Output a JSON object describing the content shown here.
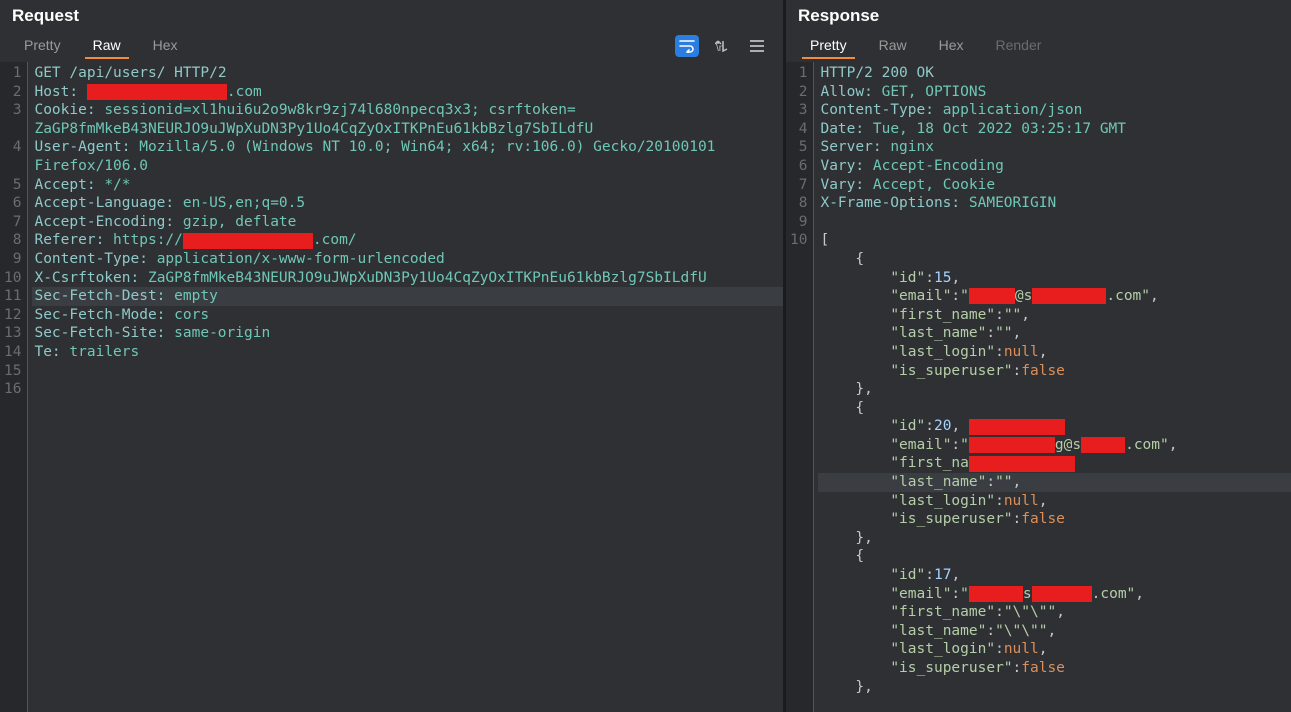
{
  "request": {
    "title": "Request",
    "tabs": {
      "pretty": "Pretty",
      "raw": "Raw",
      "hex": "Hex"
    },
    "active_tab": "raw",
    "lines": [
      {
        "n": 1,
        "parts": [
          {
            "cls": "tk-teal",
            "t": "GET"
          },
          {
            "cls": "tk-def",
            "t": " "
          },
          {
            "cls": "tk-teal",
            "t": "/api/users/"
          },
          {
            "cls": "tk-def",
            "t": " "
          },
          {
            "cls": "tk-teal",
            "t": "HTTP/2"
          }
        ]
      },
      {
        "n": 2,
        "parts": [
          {
            "cls": "tk-teal",
            "t": "Host:"
          },
          {
            "cls": "tk-def",
            "t": " "
          },
          {
            "redact": 140
          },
          {
            "cls": "tk-tealb",
            "t": ".com"
          }
        ]
      },
      {
        "n": 3,
        "wrap": true,
        "parts": [
          {
            "cls": "tk-teal",
            "t": "Cookie:"
          },
          {
            "cls": "tk-def",
            "t": " "
          },
          {
            "cls": "tk-tealb",
            "t": "sessionid=xl1hui6u2o9w8kr9zj74l680npecq3x3"
          },
          {
            "cls": "tk-tealb",
            "t": "; "
          },
          {
            "cls": "tk-tealb",
            "t": "csrftoken="
          }
        ]
      },
      {
        "n": null,
        "parts": [
          {
            "cls": "tk-tealb",
            "t": "ZaGP8fmMkeB43NEURJO9uJWpXuDN3Py1Uo4CqZyOxITKPnEu61kbBzlg7SbILdfU"
          }
        ]
      },
      {
        "n": 4,
        "wrap": true,
        "parts": [
          {
            "cls": "tk-teal",
            "t": "User-Agent:"
          },
          {
            "cls": "tk-def",
            "t": " "
          },
          {
            "cls": "tk-tealb",
            "t": "Mozilla/5.0 (Windows NT 10.0; Win64; x64; rv:106.0) Gecko/20100101 "
          }
        ]
      },
      {
        "n": null,
        "parts": [
          {
            "cls": "tk-tealb",
            "t": "Firefox/106.0"
          }
        ]
      },
      {
        "n": 5,
        "parts": [
          {
            "cls": "tk-teal",
            "t": "Accept:"
          },
          {
            "cls": "tk-def",
            "t": " "
          },
          {
            "cls": "tk-tealb",
            "t": "*/*"
          }
        ]
      },
      {
        "n": 6,
        "parts": [
          {
            "cls": "tk-teal",
            "t": "Accept-Language:"
          },
          {
            "cls": "tk-def",
            "t": " "
          },
          {
            "cls": "tk-tealb",
            "t": "en-US,en;q=0.5"
          }
        ]
      },
      {
        "n": 7,
        "parts": [
          {
            "cls": "tk-teal",
            "t": "Accept-Encoding:"
          },
          {
            "cls": "tk-def",
            "t": " "
          },
          {
            "cls": "tk-tealb",
            "t": "gzip, deflate"
          }
        ]
      },
      {
        "n": 8,
        "parts": [
          {
            "cls": "tk-teal",
            "t": "Referer:"
          },
          {
            "cls": "tk-def",
            "t": " "
          },
          {
            "cls": "tk-tealb",
            "t": "https://"
          },
          {
            "redact": 130
          },
          {
            "cls": "tk-tealb",
            "t": ".com/"
          }
        ]
      },
      {
        "n": 9,
        "parts": [
          {
            "cls": "tk-teal",
            "t": "Content-Type:"
          },
          {
            "cls": "tk-def",
            "t": " "
          },
          {
            "cls": "tk-tealb",
            "t": "application/x-www-form-urlencoded"
          }
        ]
      },
      {
        "n": 10,
        "parts": [
          {
            "cls": "tk-teal",
            "t": "X-Csrftoken:"
          },
          {
            "cls": "tk-def",
            "t": " "
          },
          {
            "cls": "tk-tealb",
            "t": "ZaGP8fmMkeB43NEURJO9uJWpXuDN3Py1Uo4CqZyOxITKPnEu61kbBzlg7SbILdfU"
          }
        ]
      },
      {
        "n": 11,
        "hl": true,
        "parts": [
          {
            "cls": "tk-teal",
            "t": "Sec-Fetch-Dest:"
          },
          {
            "cls": "tk-def",
            "t": " "
          },
          {
            "cls": "tk-tealb",
            "t": "empty"
          }
        ]
      },
      {
        "n": 12,
        "parts": [
          {
            "cls": "tk-teal",
            "t": "Sec-Fetch-Mode:"
          },
          {
            "cls": "tk-def",
            "t": " "
          },
          {
            "cls": "tk-tealb",
            "t": "cors"
          }
        ]
      },
      {
        "n": 13,
        "parts": [
          {
            "cls": "tk-teal",
            "t": "Sec-Fetch-Site:"
          },
          {
            "cls": "tk-def",
            "t": " "
          },
          {
            "cls": "tk-tealb",
            "t": "same-origin"
          }
        ]
      },
      {
        "n": 14,
        "parts": [
          {
            "cls": "tk-teal",
            "t": "Te:"
          },
          {
            "cls": "tk-def",
            "t": " "
          },
          {
            "cls": "tk-tealb",
            "t": "trailers"
          }
        ]
      },
      {
        "n": 15,
        "parts": []
      },
      {
        "n": 16,
        "parts": []
      }
    ]
  },
  "response": {
    "title": "Response",
    "tabs": {
      "pretty": "Pretty",
      "raw": "Raw",
      "hex": "Hex",
      "render": "Render"
    },
    "active_tab": "pretty",
    "lines": [
      {
        "n": 1,
        "parts": [
          {
            "cls": "tk-teal",
            "t": "HTTP/2"
          },
          {
            "cls": "tk-def",
            "t": " "
          },
          {
            "cls": "tk-teal",
            "t": "200"
          },
          {
            "cls": "tk-def",
            "t": " "
          },
          {
            "cls": "tk-teal",
            "t": "OK"
          }
        ]
      },
      {
        "n": 2,
        "parts": [
          {
            "cls": "tk-teal",
            "t": "Allow:"
          },
          {
            "cls": "tk-def",
            "t": " "
          },
          {
            "cls": "tk-tealb",
            "t": "GET, OPTIONS"
          }
        ]
      },
      {
        "n": 3,
        "parts": [
          {
            "cls": "tk-teal",
            "t": "Content-Type:"
          },
          {
            "cls": "tk-def",
            "t": " "
          },
          {
            "cls": "tk-tealb",
            "t": "application/json"
          }
        ]
      },
      {
        "n": 4,
        "parts": [
          {
            "cls": "tk-teal",
            "t": "Date:"
          },
          {
            "cls": "tk-def",
            "t": " "
          },
          {
            "cls": "tk-tealb",
            "t": "Tue, 18 Oct 2022 03:25:17 GMT"
          }
        ]
      },
      {
        "n": 5,
        "parts": [
          {
            "cls": "tk-teal",
            "t": "Server:"
          },
          {
            "cls": "tk-def",
            "t": " "
          },
          {
            "cls": "tk-tealb",
            "t": "nginx"
          }
        ]
      },
      {
        "n": 6,
        "parts": [
          {
            "cls": "tk-teal",
            "t": "Vary:"
          },
          {
            "cls": "tk-def",
            "t": " "
          },
          {
            "cls": "tk-tealb",
            "t": "Accept-Encoding"
          }
        ]
      },
      {
        "n": 7,
        "parts": [
          {
            "cls": "tk-teal",
            "t": "Vary:"
          },
          {
            "cls": "tk-def",
            "t": " "
          },
          {
            "cls": "tk-tealb",
            "t": "Accept, Cookie"
          }
        ]
      },
      {
        "n": 8,
        "parts": [
          {
            "cls": "tk-teal",
            "t": "X-Frame-Options:"
          },
          {
            "cls": "tk-def",
            "t": " "
          },
          {
            "cls": "tk-tealb",
            "t": "SAMEORIGIN"
          }
        ]
      },
      {
        "n": 9,
        "parts": []
      },
      {
        "n": 10,
        "parts": [
          {
            "cls": "tk-brace",
            "t": "["
          }
        ]
      },
      {
        "n": null,
        "indent": 4,
        "parts": [
          {
            "cls": "tk-brace",
            "t": "{"
          }
        ]
      },
      {
        "n": null,
        "indent": 8,
        "parts": [
          {
            "cls": "tk-key",
            "t": "\"id\""
          },
          {
            "cls": "tk-def",
            "t": ":"
          },
          {
            "cls": "tk-num",
            "t": "15"
          },
          {
            "cls": "tk-def",
            "t": ","
          }
        ]
      },
      {
        "n": null,
        "indent": 8,
        "parts": [
          {
            "cls": "tk-key",
            "t": "\"email\""
          },
          {
            "cls": "tk-def",
            "t": ":"
          },
          {
            "cls": "tk-key",
            "t": "\""
          },
          {
            "redact": 46
          },
          {
            "cls": "tk-key",
            "t": "@s"
          },
          {
            "redact": 74
          },
          {
            "cls": "tk-key",
            "t": ".com\""
          },
          {
            "cls": "tk-def",
            "t": ","
          }
        ]
      },
      {
        "n": null,
        "indent": 8,
        "parts": [
          {
            "cls": "tk-key",
            "t": "\"first_name\""
          },
          {
            "cls": "tk-def",
            "t": ":"
          },
          {
            "cls": "tk-key",
            "t": "\"\""
          },
          {
            "cls": "tk-def",
            "t": ","
          }
        ]
      },
      {
        "n": null,
        "indent": 8,
        "parts": [
          {
            "cls": "tk-key",
            "t": "\"last_name\""
          },
          {
            "cls": "tk-def",
            "t": ":"
          },
          {
            "cls": "tk-key",
            "t": "\"\""
          },
          {
            "cls": "tk-def",
            "t": ","
          }
        ]
      },
      {
        "n": null,
        "indent": 8,
        "parts": [
          {
            "cls": "tk-key",
            "t": "\"last_login\""
          },
          {
            "cls": "tk-def",
            "t": ":"
          },
          {
            "cls": "tk-kw",
            "t": "null"
          },
          {
            "cls": "tk-def",
            "t": ","
          }
        ]
      },
      {
        "n": null,
        "indent": 8,
        "parts": [
          {
            "cls": "tk-key",
            "t": "\"is_superuser\""
          },
          {
            "cls": "tk-def",
            "t": ":"
          },
          {
            "cls": "tk-kw",
            "t": "false"
          }
        ]
      },
      {
        "n": null,
        "indent": 4,
        "parts": [
          {
            "cls": "tk-brace",
            "t": "},"
          }
        ]
      },
      {
        "n": null,
        "indent": 4,
        "parts": [
          {
            "cls": "tk-brace",
            "t": "{"
          }
        ]
      },
      {
        "n": null,
        "indent": 8,
        "parts": [
          {
            "cls": "tk-key",
            "t": "\"id\""
          },
          {
            "cls": "tk-def",
            "t": ":"
          },
          {
            "cls": "tk-num",
            "t": "20"
          },
          {
            "cls": "tk-def",
            "t": ","
          },
          {
            "cls": "tk-def",
            "t": " "
          },
          {
            "redact": 96
          }
        ]
      },
      {
        "n": null,
        "indent": 8,
        "parts": [
          {
            "cls": "tk-key",
            "t": "\"email\""
          },
          {
            "cls": "tk-def",
            "t": ":"
          },
          {
            "cls": "tk-key",
            "t": "\""
          },
          {
            "redact": 86
          },
          {
            "cls": "tk-key",
            "t": "g@s"
          },
          {
            "redact": 44
          },
          {
            "cls": "tk-key",
            "t": ".com\""
          },
          {
            "cls": "tk-def",
            "t": ","
          }
        ]
      },
      {
        "n": null,
        "indent": 8,
        "parts": [
          {
            "cls": "tk-key",
            "t": "\"first_na"
          },
          {
            "redact": 106
          }
        ]
      },
      {
        "n": null,
        "indent": 8,
        "hl": true,
        "parts": [
          {
            "cls": "tk-key",
            "t": "\"last_name\""
          },
          {
            "cls": "tk-def",
            "t": ":"
          },
          {
            "cls": "tk-key",
            "t": "\"\""
          },
          {
            "cls": "tk-def",
            "t": ","
          }
        ]
      },
      {
        "n": null,
        "indent": 8,
        "parts": [
          {
            "cls": "tk-key",
            "t": "\"last_login\""
          },
          {
            "cls": "tk-def",
            "t": ":"
          },
          {
            "cls": "tk-kw",
            "t": "null"
          },
          {
            "cls": "tk-def",
            "t": ","
          }
        ]
      },
      {
        "n": null,
        "indent": 8,
        "parts": [
          {
            "cls": "tk-key",
            "t": "\"is_superuser\""
          },
          {
            "cls": "tk-def",
            "t": ":"
          },
          {
            "cls": "tk-kw",
            "t": "false"
          }
        ]
      },
      {
        "n": null,
        "indent": 4,
        "parts": [
          {
            "cls": "tk-brace",
            "t": "},"
          }
        ]
      },
      {
        "n": null,
        "indent": 4,
        "parts": [
          {
            "cls": "tk-brace",
            "t": "{"
          }
        ]
      },
      {
        "n": null,
        "indent": 8,
        "parts": [
          {
            "cls": "tk-key",
            "t": "\"id\""
          },
          {
            "cls": "tk-def",
            "t": ":"
          },
          {
            "cls": "tk-num",
            "t": "17"
          },
          {
            "cls": "tk-def",
            "t": ","
          }
        ]
      },
      {
        "n": null,
        "indent": 8,
        "parts": [
          {
            "cls": "tk-key",
            "t": "\"email\""
          },
          {
            "cls": "tk-def",
            "t": ":"
          },
          {
            "cls": "tk-key",
            "t": "\""
          },
          {
            "redact": 54
          },
          {
            "cls": "tk-key",
            "t": "s"
          },
          {
            "redact": 60
          },
          {
            "cls": "tk-key",
            "t": ".com\""
          },
          {
            "cls": "tk-def",
            "t": ","
          }
        ]
      },
      {
        "n": null,
        "indent": 8,
        "parts": [
          {
            "cls": "tk-key",
            "t": "\"first_name\""
          },
          {
            "cls": "tk-def",
            "t": ":"
          },
          {
            "cls": "tk-key",
            "t": "\"\\\"\\\"\""
          },
          {
            "cls": "tk-def",
            "t": ","
          }
        ]
      },
      {
        "n": null,
        "indent": 8,
        "parts": [
          {
            "cls": "tk-key",
            "t": "\"last_name\""
          },
          {
            "cls": "tk-def",
            "t": ":"
          },
          {
            "cls": "tk-key",
            "t": "\"\\\"\\\"\""
          },
          {
            "cls": "tk-def",
            "t": ","
          }
        ]
      },
      {
        "n": null,
        "indent": 8,
        "parts": [
          {
            "cls": "tk-key",
            "t": "\"last_login\""
          },
          {
            "cls": "tk-def",
            "t": ":"
          },
          {
            "cls": "tk-kw",
            "t": "null"
          },
          {
            "cls": "tk-def",
            "t": ","
          }
        ]
      },
      {
        "n": null,
        "indent": 8,
        "parts": [
          {
            "cls": "tk-key",
            "t": "\"is_superuser\""
          },
          {
            "cls": "tk-def",
            "t": ":"
          },
          {
            "cls": "tk-kw",
            "t": "false"
          }
        ]
      },
      {
        "n": null,
        "indent": 4,
        "parts": [
          {
            "cls": "tk-brace",
            "t": "},"
          }
        ]
      }
    ]
  }
}
